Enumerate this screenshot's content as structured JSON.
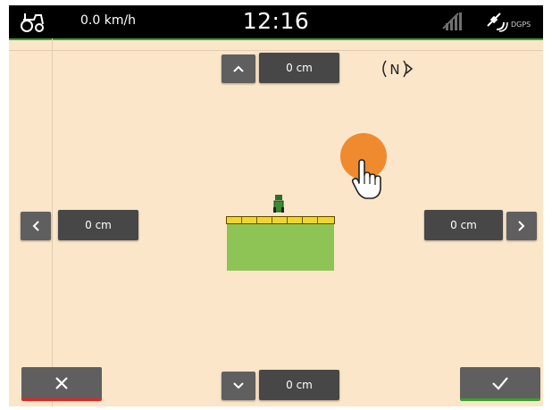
{
  "status_bar": {
    "speed": "0.0 km/h",
    "time": "12:16",
    "gps_label": "DGPS",
    "icons": [
      "tractor-icon",
      "signal-icon",
      "satellite-icon"
    ]
  },
  "compass_label": "N",
  "offsets": {
    "forward": "0 cm",
    "backward": "0 cm",
    "left": "0 cm",
    "right": "0 cm"
  },
  "colors": {
    "background": "#fbe6c9",
    "status_bar": "#000000",
    "accent_green": "#3ba12f",
    "cancel_red": "#e0281f",
    "implement_yellow": "#f2d52a",
    "covered_area": "#8ec455",
    "touch_indicator": "#f08a2e"
  }
}
